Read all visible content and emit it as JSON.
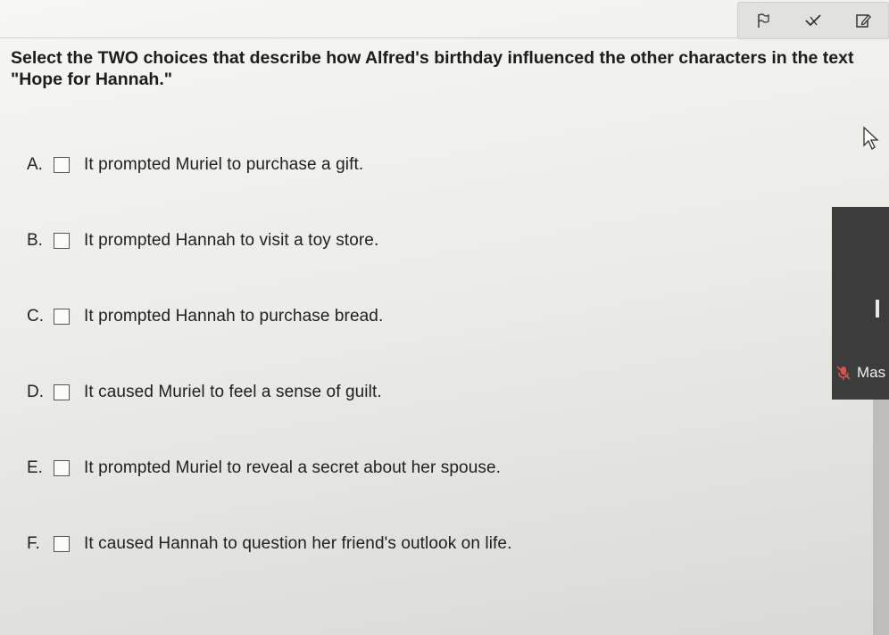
{
  "toolbar": {
    "flag_icon": "flag-icon",
    "strike_icon": "strikethrough-check-icon",
    "edit_icon": "pencil-edit-icon"
  },
  "question": {
    "text": "Select the TWO choices that describe how Alfred's birthday influenced the other characters in the text \"Hope for Hannah.\""
  },
  "choices": [
    {
      "letter": "A.",
      "text": "It prompted Muriel to purchase a gift."
    },
    {
      "letter": "B.",
      "text": "It prompted Hannah to visit a toy store."
    },
    {
      "letter": "C.",
      "text": "It prompted Hannah to purchase bread."
    },
    {
      "letter": "D.",
      "text": "It caused Muriel to feel a sense of guilt."
    },
    {
      "letter": "E.",
      "text": "It prompted Muriel to reveal a secret about her spouse."
    },
    {
      "letter": "F.",
      "text": "It caused Hannah to question her friend's outlook on life."
    }
  ],
  "side_panel": {
    "label": "Mas",
    "icon": "muted-microphone-icon"
  },
  "colors": {
    "side_panel_bg": "#3c3c3c",
    "mic_icon": "#d9534f"
  }
}
